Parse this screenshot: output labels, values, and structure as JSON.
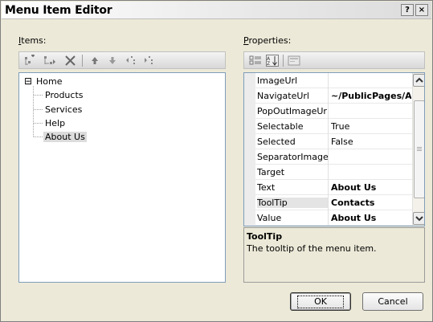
{
  "window": {
    "title": "Menu Item Editor",
    "help_btn": "?",
    "close_btn": "×"
  },
  "items_panel": {
    "label_prefix": "",
    "label_accel": "I",
    "label_rest": "tems:",
    "toolbar_icons": [
      "add-root-item-icon",
      "add-child-item-icon",
      "delete-icon",
      "move-up-icon",
      "move-down-icon",
      "outdent-icon",
      "indent-icon"
    ],
    "tree": {
      "root": {
        "label": "Home",
        "expander": "⊟"
      },
      "children": [
        {
          "label": "Products"
        },
        {
          "label": "Services"
        },
        {
          "label": "Help"
        },
        {
          "label": "About Us",
          "selected": true
        }
      ]
    }
  },
  "properties_panel": {
    "label_accel": "P",
    "label_rest": "roperties:",
    "toolbar_icons": [
      "categorized-icon",
      "alphabetical-icon",
      "property-pages-icon"
    ],
    "rows": [
      {
        "name": "ImageUrl",
        "value": "",
        "bold": false
      },
      {
        "name": "NavigateUrl",
        "value": "~/PublicPages/A",
        "bold": true
      },
      {
        "name": "PopOutImageUr",
        "value": "",
        "bold": false
      },
      {
        "name": "Selectable",
        "value": "True",
        "bold": false
      },
      {
        "name": "Selected",
        "value": "False",
        "bold": false
      },
      {
        "name": "SeparatorImage",
        "value": "",
        "bold": false
      },
      {
        "name": "Target",
        "value": "",
        "bold": false
      },
      {
        "name": "Text",
        "value": "About Us",
        "bold": true
      },
      {
        "name": "ToolTip",
        "value": "Contacts",
        "bold": true,
        "selected": true
      },
      {
        "name": "Value",
        "value": "About Us",
        "bold": true
      }
    ],
    "description": {
      "title": "ToolTip",
      "text": "The tooltip of the menu item."
    }
  },
  "buttons": {
    "ok": "OK",
    "cancel": "Cancel"
  }
}
